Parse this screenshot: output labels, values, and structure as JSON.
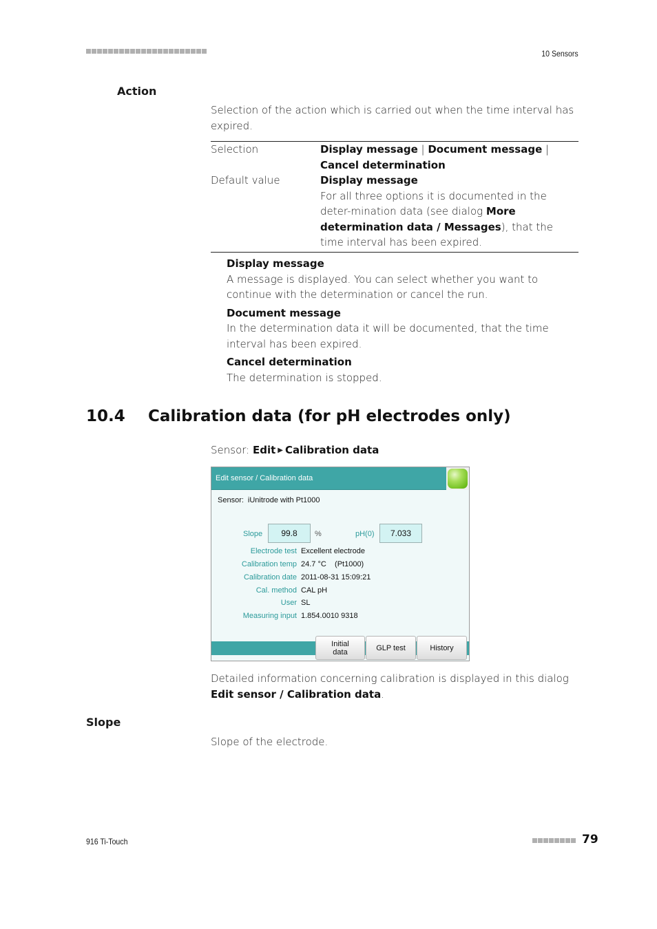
{
  "header": {
    "chapter": "10 Sensors"
  },
  "action_section": {
    "heading": "Action",
    "description": "Selection of the action which is carried out when the time interval has expired.",
    "table": {
      "selection_label": "Selection",
      "selection_options": [
        "Display message",
        "Document message",
        "Cancel determination"
      ],
      "separator": " | ",
      "default_label": "Default value",
      "default_value": "Display message",
      "note_pre": "For all three options it is documented in the deter-mination data (see dialog ",
      "note_bold": "More determination data / Messages",
      "note_post": "), that the time interval has been expired."
    },
    "options": [
      {
        "title": "Display message",
        "text": "A message is displayed. You can select whether you want to continue with the determination or cancel the run."
      },
      {
        "title": "Document message",
        "text": "In the determination data it will be documented, that the time interval has been expired."
      },
      {
        "title": "Cancel determination",
        "text": "The determination is stopped."
      }
    ]
  },
  "section": {
    "number": "10.4",
    "title": "Calibration data (for pH electrodes only)"
  },
  "menu_path": {
    "prefix": "Sensor: ",
    "step1": "Edit",
    "arrow": "▶",
    "step2": "Calibration data"
  },
  "dialog": {
    "title": "Edit sensor / Calibration data",
    "home_icon": "home-button-icon",
    "sensor_label": "Sensor:",
    "sensor_value": "iUnitrode with Pt1000",
    "slope_label": "Slope",
    "slope_value": "99.8",
    "slope_unit": "%",
    "ph0_label": "pH(0)",
    "ph0_value": "7.033",
    "info": [
      {
        "key": "Electrode test",
        "value": "Excellent electrode"
      },
      {
        "key": "Calibration temp",
        "value": "24.7 °C    (Pt1000)"
      },
      {
        "key": "Calibration date",
        "value": "2011-08-31 15:09:21"
      },
      {
        "key": "Cal. method",
        "value": "CAL pH"
      },
      {
        "key": "User",
        "value": "SL"
      },
      {
        "key": "Measuring input",
        "value": "1.854.0010 9318"
      }
    ],
    "buttons": {
      "initial_data_line1": "Initial",
      "initial_data_line2": "data",
      "glp_test": "GLP test",
      "history": "History"
    }
  },
  "detail_text": {
    "pre": "Detailed information concerning calibration is displayed in this dialog ",
    "bold": "Edit sensor / Calibration data",
    "post": "."
  },
  "slope_section": {
    "heading": "Slope",
    "text": "Slope of the electrode."
  },
  "footer": {
    "product": "916 Ti-Touch",
    "page": "79"
  }
}
